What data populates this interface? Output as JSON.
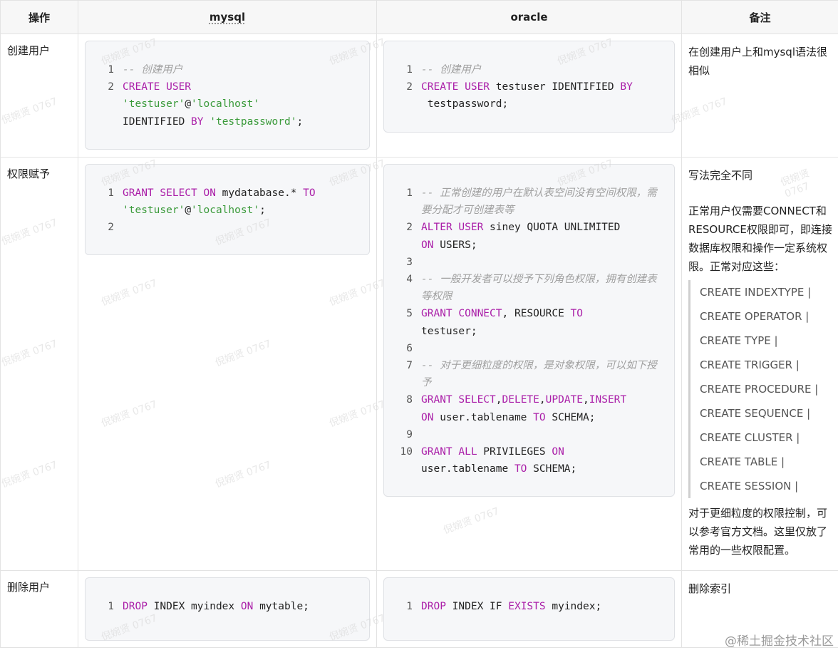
{
  "headers": {
    "op": "操作",
    "mysql": "mysql",
    "oracle": "oracle",
    "note": "备注"
  },
  "rows": [
    {
      "op": "创建用户",
      "mysql_lines": [
        {
          "n": "1",
          "tokens": [
            {
              "t": "-- 创建用户",
              "c": "cmt"
            }
          ]
        },
        {
          "n": "2",
          "tokens": [
            {
              "t": "CREATE USER",
              "c": "kw"
            },
            {
              "t": "\n"
            },
            {
              "t": "'testuser'",
              "c": "str"
            },
            {
              "t": "@"
            },
            {
              "t": "'localhost'",
              "c": "str"
            },
            {
              "t": "\nIDENTIFIED "
            },
            {
              "t": "BY",
              "c": "kw"
            },
            {
              "t": " "
            },
            {
              "t": "'testpassword'",
              "c": "str"
            },
            {
              "t": ";"
            }
          ]
        }
      ],
      "oracle_lines": [
        {
          "n": "1",
          "tokens": [
            {
              "t": "-- 创建用户",
              "c": "cmt"
            }
          ]
        },
        {
          "n": "2",
          "tokens": [
            {
              "t": "CREATE USER",
              "c": "kw"
            },
            {
              "t": " testuser IDENTIFIED "
            },
            {
              "t": "BY",
              "c": "kw"
            },
            {
              "t": "\n testpassword;"
            }
          ]
        }
      ],
      "note": "在创建用户上和mysql语法很相似"
    },
    {
      "op": "权限赋予",
      "mysql_lines": [
        {
          "n": "1",
          "tokens": [
            {
              "t": "GRANT SELECT ON",
              "c": "kw"
            },
            {
              "t": " mydatabase.* "
            },
            {
              "t": "TO",
              "c": "kw"
            },
            {
              "t": "\n"
            },
            {
              "t": "'testuser'",
              "c": "str"
            },
            {
              "t": "@"
            },
            {
              "t": "'localhost'",
              "c": "str"
            },
            {
              "t": ";"
            }
          ]
        },
        {
          "n": "2",
          "tokens": [
            {
              "t": " "
            }
          ]
        }
      ],
      "oracle_lines": [
        {
          "n": "1",
          "tokens": [
            {
              "t": "-- 正常创建的用户在默认表空间没有空间权限，需要分配才可创建表等",
              "c": "cmt"
            }
          ]
        },
        {
          "n": "2",
          "tokens": [
            {
              "t": "ALTER USER",
              "c": "kw"
            },
            {
              "t": " siney QUOTA UNLIMITED\n"
            },
            {
              "t": "ON",
              "c": "kw"
            },
            {
              "t": " USERS;"
            }
          ]
        },
        {
          "n": "3",
          "tokens": [
            {
              "t": " "
            }
          ]
        },
        {
          "n": "4",
          "tokens": [
            {
              "t": "-- 一般开发者可以授予下列角色权限，拥有创建表等权限",
              "c": "cmt"
            }
          ]
        },
        {
          "n": "5",
          "tokens": [
            {
              "t": "GRANT CONNECT",
              "c": "kw"
            },
            {
              "t": ", RESOURCE "
            },
            {
              "t": "TO",
              "c": "kw"
            },
            {
              "t": "\ntestuser;"
            }
          ]
        },
        {
          "n": "6",
          "tokens": [
            {
              "t": " "
            }
          ]
        },
        {
          "n": "7",
          "tokens": [
            {
              "t": "-- 对于更细粒度的权限，是对象权限，可以如下授予",
              "c": "cmt"
            }
          ]
        },
        {
          "n": "8",
          "tokens": [
            {
              "t": "GRANT SELECT",
              "c": "kw"
            },
            {
              "t": ","
            },
            {
              "t": "DELETE",
              "c": "kw"
            },
            {
              "t": ","
            },
            {
              "t": "UPDATE",
              "c": "kw"
            },
            {
              "t": ","
            },
            {
              "t": "INSERT",
              "c": "kw"
            },
            {
              "t": "\n"
            },
            {
              "t": "ON",
              "c": "kw"
            },
            {
              "t": " user.tablename "
            },
            {
              "t": "TO",
              "c": "kw"
            },
            {
              "t": " SCHEMA;"
            }
          ]
        },
        {
          "n": "9",
          "tokens": [
            {
              "t": " "
            }
          ]
        },
        {
          "n": "10",
          "tokens": [
            {
              "t": "GRANT ALL",
              "c": "kw"
            },
            {
              "t": " PRIVILEGES "
            },
            {
              "t": "ON",
              "c": "kw"
            },
            {
              "t": "\nuser.tablename "
            },
            {
              "t": "TO",
              "c": "kw"
            },
            {
              "t": " SCHEMA;"
            }
          ]
        }
      ],
      "note_intro": "写法完全不同",
      "note_para": "正常用户仅需要CONNECT和RESOURCE权限即可，即连接数据库权限和操作一定系统权限。正常对应这些：",
      "note_list": [
        "CREATE INDEXTYPE |",
        "CREATE OPERATOR |",
        "CREATE TYPE |",
        "CREATE TRIGGER |",
        "CREATE PROCEDURE |",
        "CREATE SEQUENCE |",
        "CREATE CLUSTER |",
        "CREATE TABLE |",
        "CREATE SESSION |"
      ],
      "note_outro": "对于更细粒度的权限控制，可以参考官方文档。这里仅放了常用的一些权限配置。"
    },
    {
      "op": "删除用户",
      "mysql_lines": [
        {
          "n": "1",
          "tokens": [
            {
              "t": "DROP",
              "c": "kw"
            },
            {
              "t": " INDEX myindex "
            },
            {
              "t": "ON",
              "c": "kw"
            },
            {
              "t": " mytable;"
            }
          ]
        }
      ],
      "oracle_lines": [
        {
          "n": "1",
          "tokens": [
            {
              "t": "DROP",
              "c": "kw"
            },
            {
              "t": " INDEX IF "
            },
            {
              "t": "EXISTS",
              "c": "kw"
            },
            {
              "t": " myindex;"
            }
          ]
        }
      ],
      "note": "删除索引"
    }
  ],
  "footer": "@稀土掘金技术社区",
  "watermark": "倪婉贤 0767"
}
